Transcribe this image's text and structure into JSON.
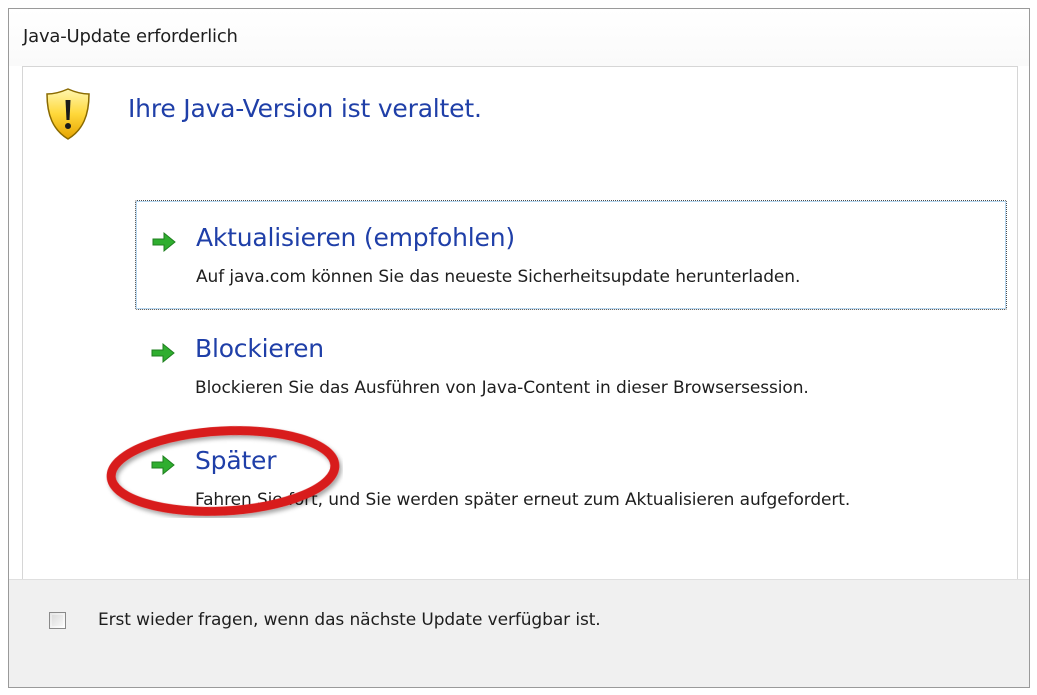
{
  "window": {
    "title": "Java-Update erforderlich"
  },
  "header": {
    "icon": "warning-shield-icon",
    "heading": "Ihre Java-Version ist veraltet."
  },
  "options": [
    {
      "title": "Aktualisieren (empfohlen)",
      "description": "Auf java.com können Sie das neueste Sicherheitsupdate herunterladen.",
      "icon": "green-arrow-icon",
      "focused": true
    },
    {
      "title": "Blockieren",
      "description": "Blockieren Sie das Ausführen von Java-Content in dieser Browsersession.",
      "icon": "green-arrow-icon",
      "focused": false
    },
    {
      "title": "Später",
      "description": "Fahren Sie fort, und Sie werden später erneut zum Aktualisieren aufgefordert.",
      "icon": "green-arrow-icon",
      "focused": false
    }
  ],
  "footer": {
    "checkbox_checked": false,
    "checkbox_label": "Erst wieder fragen, wenn das nächste Update verfügbar ist."
  },
  "annotation": {
    "highlight_color": "#d81c1c"
  },
  "colors": {
    "accent_text": "#1f3fa8",
    "arrow_green": "#2fae2f",
    "footer_bg": "#f0f0f0"
  }
}
